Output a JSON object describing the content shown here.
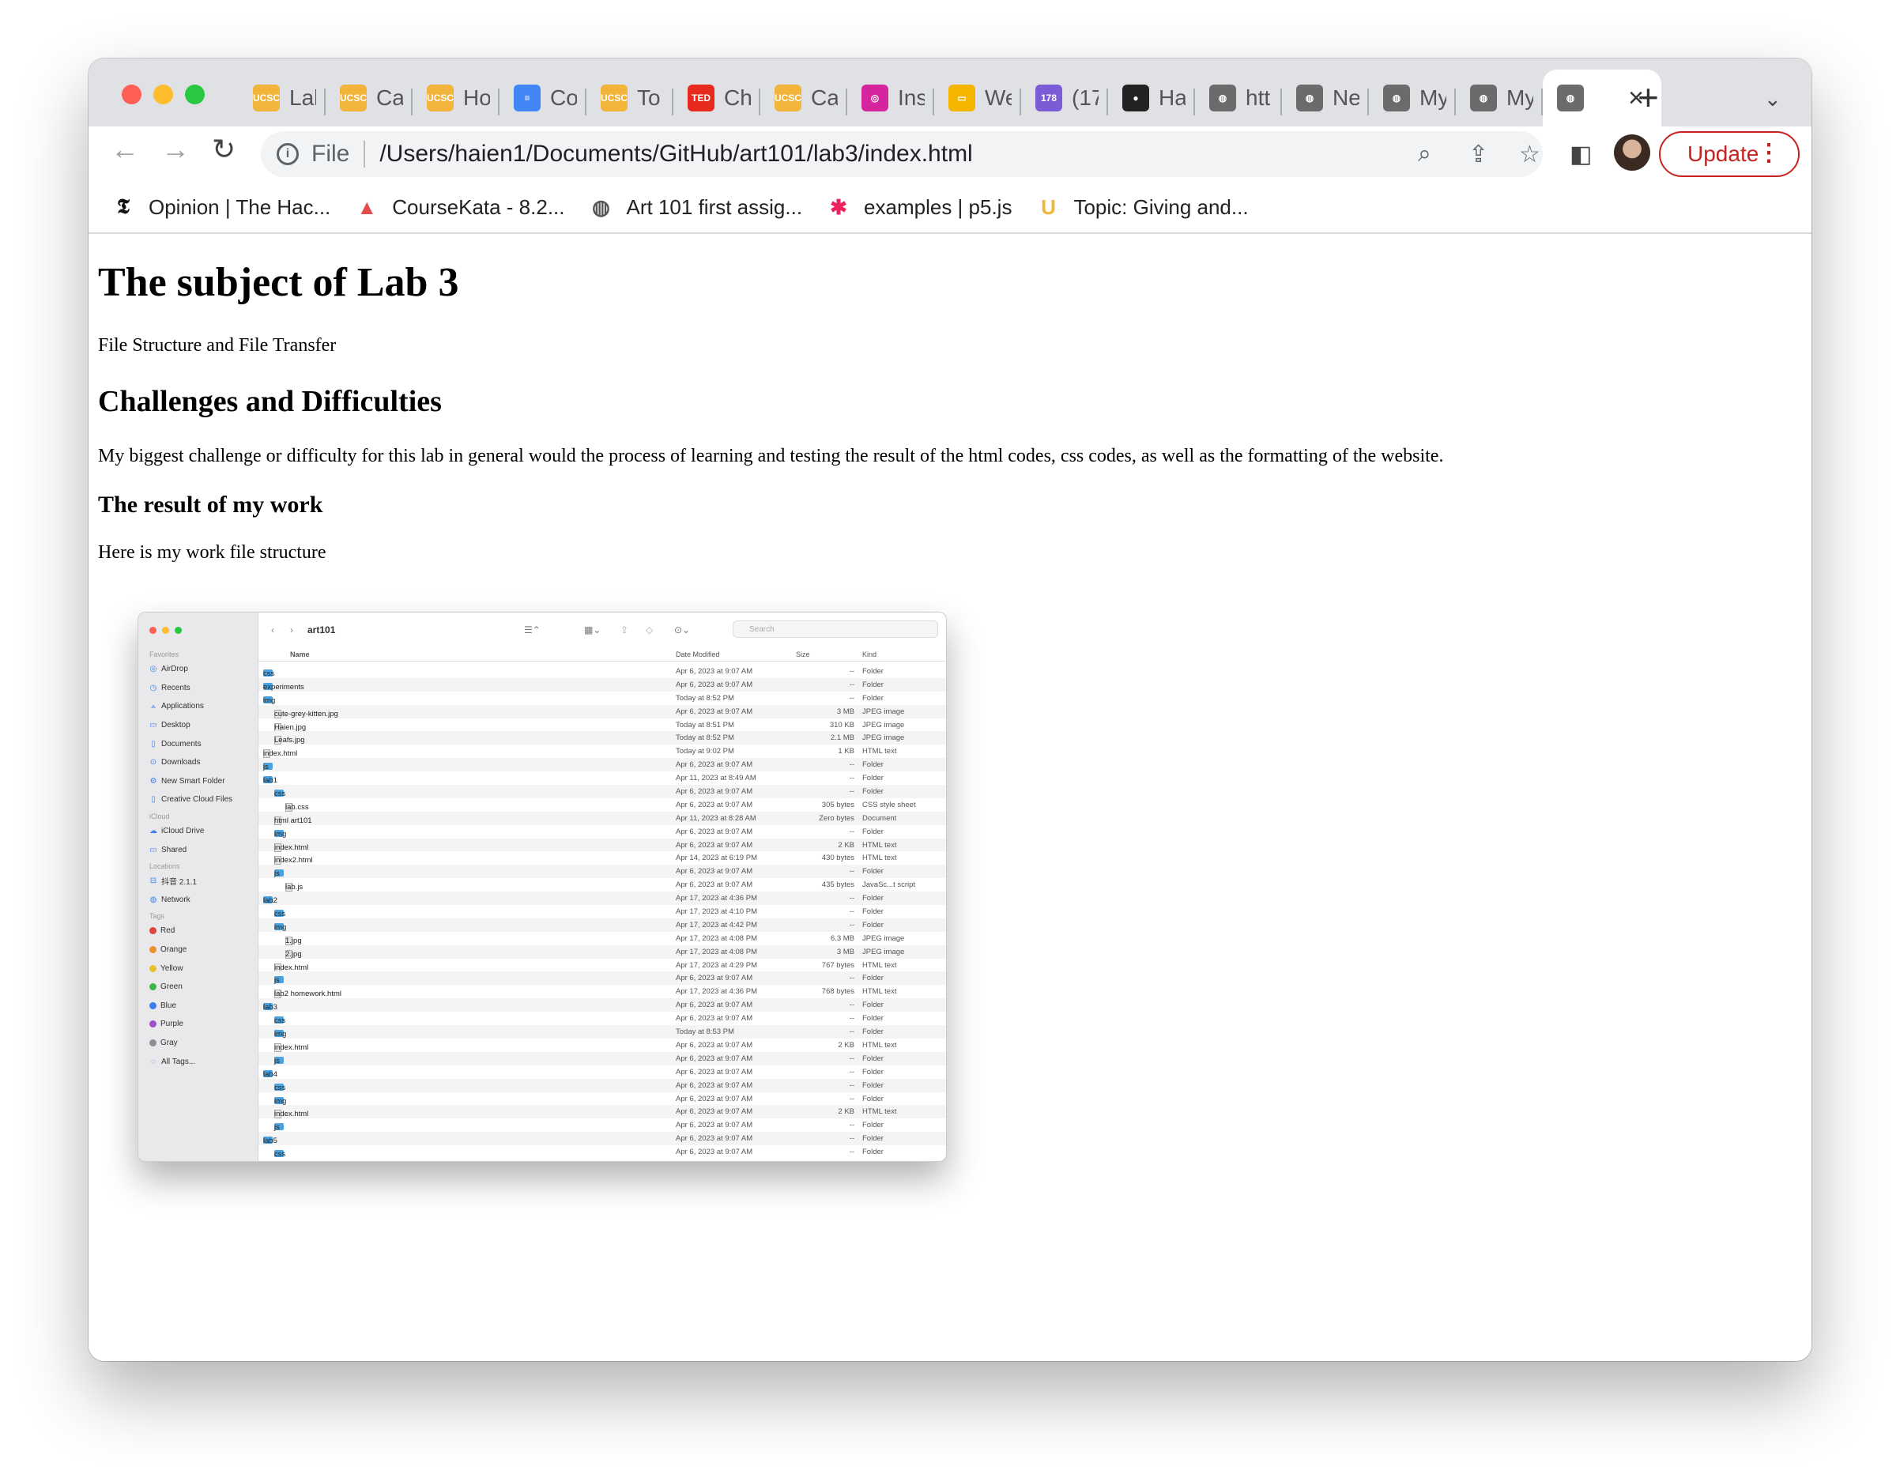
{
  "browser": {
    "tabs": [
      {
        "title": "Lab",
        "fav": "UCSC",
        "color": "#f2b43a"
      },
      {
        "title": "Ca",
        "fav": "UCSC",
        "color": "#f2b43a"
      },
      {
        "title": "Ho",
        "fav": "UCSC",
        "color": "#f2b43a"
      },
      {
        "title": "Co",
        "fav": "≡",
        "color": "#4285f4"
      },
      {
        "title": "To",
        "fav": "UCSC",
        "color": "#f2b43a"
      },
      {
        "title": "Ch",
        "fav": "TED",
        "color": "#e62b1e"
      },
      {
        "title": "Ca",
        "fav": "UCSC",
        "color": "#f2b43a"
      },
      {
        "title": "Ins",
        "fav": "◎",
        "color": "#d6249f"
      },
      {
        "title": "We",
        "fav": "▭",
        "color": "#f4b400"
      },
      {
        "title": "(17",
        "fav": "178",
        "color": "#7b5cd6"
      },
      {
        "title": "Ha",
        "fav": "●",
        "color": "#222222"
      },
      {
        "title": "htt",
        "fav": "◍",
        "color": "#6b6b6b"
      },
      {
        "title": "Ne",
        "fav": "◍",
        "color": "#6b6b6b"
      },
      {
        "title": "My",
        "fav": "◍",
        "color": "#6b6b6b"
      },
      {
        "title": "My",
        "fav": "◍",
        "color": "#6b6b6b"
      }
    ],
    "address": {
      "scheme": "File",
      "url": "/Users/haien1/Documents/GitHub/art101/lab3/index.html"
    },
    "update_label": "Update",
    "bookmarks": [
      {
        "label": "Opinion | The Hac...",
        "icon": "𝕿",
        "color": "#111111"
      },
      {
        "label": "CourseKata - 8.2...",
        "icon": "▲",
        "color": "#e24c4c"
      },
      {
        "label": "Art 101 first assig...",
        "icon": "◍",
        "color": "#555555"
      },
      {
        "label": "examples | p5.js",
        "icon": "✱",
        "color": "#ed225d"
      },
      {
        "label": "Topic: Giving and...",
        "icon": "U",
        "color": "#f2b43a"
      }
    ]
  },
  "page": {
    "title": "The subject of Lab 3",
    "subtitle": "File Structure and File Transfer",
    "challenges_heading": "Challenges and Difficulties",
    "challenges_text": "My biggest challenge or difficulty for this lab in general would the process of learning and testing the result of the html codes, css codes, as well as the formatting of the website.",
    "result_heading": "The result of my work",
    "result_text": "Here is my work file structure"
  },
  "finder": {
    "path": "art101",
    "search_placeholder": "Search",
    "columns": [
      "Name",
      "Date Modified",
      "Size",
      "Kind"
    ],
    "sidebar": [
      {
        "section": "Favorites"
      },
      {
        "label": "AirDrop",
        "icon": "◎"
      },
      {
        "label": "Recents",
        "icon": "◷"
      },
      {
        "label": "Applications",
        "icon": "⟑"
      },
      {
        "label": "Desktop",
        "icon": "▭"
      },
      {
        "label": "Documents",
        "icon": "▯"
      },
      {
        "label": "Downloads",
        "icon": "⊙"
      },
      {
        "label": "New Smart Folder",
        "icon": "⚙"
      },
      {
        "label": "Creative Cloud Files",
        "icon": "▯"
      },
      {
        "section": "iCloud"
      },
      {
        "label": "iCloud Drive",
        "icon": "☁"
      },
      {
        "label": "Shared",
        "icon": "▭"
      },
      {
        "section": "Locations"
      },
      {
        "label": "抖音 2.1.1",
        "icon": "⊟"
      },
      {
        "label": "Network",
        "icon": "◍"
      },
      {
        "section": "Tags"
      },
      {
        "label": "Red",
        "tag": "#e0443a"
      },
      {
        "label": "Orange",
        "tag": "#f0902a"
      },
      {
        "label": "Yellow",
        "tag": "#e8c12a"
      },
      {
        "label": "Green",
        "tag": "#3cb84a"
      },
      {
        "label": "Blue",
        "tag": "#3a7ff0"
      },
      {
        "label": "Purple",
        "tag": "#a050d0"
      },
      {
        "label": "Gray",
        "tag": "#8e8e93"
      },
      {
        "label": "All Tags...",
        "icon": "◌"
      }
    ],
    "rows": [
      {
        "d": 0,
        "c": ">",
        "t": "f",
        "name": "css",
        "date": "Apr 6, 2023 at 9:07 AM",
        "size": "--",
        "kind": "Folder"
      },
      {
        "d": 0,
        "c": ">",
        "t": "f",
        "name": "experiments",
        "date": "Apr 6, 2023 at 9:07 AM",
        "size": "--",
        "kind": "Folder"
      },
      {
        "d": 0,
        "c": "v",
        "t": "f",
        "name": "img",
        "date": "Today at 8:52 PM",
        "size": "--",
        "kind": "Folder"
      },
      {
        "d": 1,
        "c": "",
        "t": "d",
        "name": "cute-grey-kitten.jpg",
        "date": "Apr 6, 2023 at 9:07 AM",
        "size": "3 MB",
        "kind": "JPEG image"
      },
      {
        "d": 1,
        "c": "",
        "t": "d",
        "name": "Haien.jpg",
        "date": "Today at 8:51 PM",
        "size": "310 KB",
        "kind": "JPEG image"
      },
      {
        "d": 1,
        "c": "",
        "t": "d",
        "name": "Leafs.jpg",
        "date": "Today at 8:52 PM",
        "size": "2.1 MB",
        "kind": "JPEG image"
      },
      {
        "d": 0,
        "c": "",
        "t": "d",
        "name": "index.html",
        "date": "Today at 9:02 PM",
        "size": "1 KB",
        "kind": "HTML text"
      },
      {
        "d": 0,
        "c": ">",
        "t": "f",
        "name": "js",
        "date": "Apr 6, 2023 at 9:07 AM",
        "size": "--",
        "kind": "Folder"
      },
      {
        "d": 0,
        "c": "v",
        "t": "f",
        "name": "lab1",
        "date": "Apr 11, 2023 at 8:49 AM",
        "size": "--",
        "kind": "Folder"
      },
      {
        "d": 1,
        "c": "v",
        "t": "f",
        "name": "css",
        "date": "Apr 6, 2023 at 9:07 AM",
        "size": "--",
        "kind": "Folder"
      },
      {
        "d": 2,
        "c": "",
        "t": "d",
        "name": "lab.css",
        "date": "Apr 6, 2023 at 9:07 AM",
        "size": "305 bytes",
        "kind": "CSS style sheet"
      },
      {
        "d": 1,
        "c": "",
        "t": "d",
        "name": "html art101",
        "date": "Apr 11, 2023 at 8:28 AM",
        "size": "Zero bytes",
        "kind": "Document"
      },
      {
        "d": 1,
        "c": "v",
        "t": "f",
        "name": "img",
        "date": "Apr 6, 2023 at 9:07 AM",
        "size": "--",
        "kind": "Folder"
      },
      {
        "d": 1,
        "c": "",
        "t": "d",
        "name": "index.html",
        "date": "Apr 6, 2023 at 9:07 AM",
        "size": "2 KB",
        "kind": "HTML text"
      },
      {
        "d": 1,
        "c": "",
        "t": "d",
        "name": "index2.html",
        "date": "Apr 14, 2023 at 6:19 PM",
        "size": "430 bytes",
        "kind": "HTML text"
      },
      {
        "d": 1,
        "c": "v",
        "t": "f",
        "name": "js",
        "date": "Apr 6, 2023 at 9:07 AM",
        "size": "--",
        "kind": "Folder"
      },
      {
        "d": 2,
        "c": "",
        "t": "d",
        "name": "lab.js",
        "date": "Apr 6, 2023 at 9:07 AM",
        "size": "435 bytes",
        "kind": "JavaSc...t script"
      },
      {
        "d": 0,
        "c": "v",
        "t": "f",
        "name": "lab2",
        "date": "Apr 17, 2023 at 4:36 PM",
        "size": "--",
        "kind": "Folder"
      },
      {
        "d": 1,
        "c": ">",
        "t": "f",
        "name": "css",
        "date": "Apr 17, 2023 at 4:10 PM",
        "size": "--",
        "kind": "Folder"
      },
      {
        "d": 1,
        "c": "v",
        "t": "f",
        "name": "img",
        "date": "Apr 17, 2023 at 4:42 PM",
        "size": "--",
        "kind": "Folder"
      },
      {
        "d": 2,
        "c": "",
        "t": "d",
        "name": "1.jpg",
        "date": "Apr 17, 2023 at 4:08 PM",
        "size": "6.3 MB",
        "kind": "JPEG image"
      },
      {
        "d": 2,
        "c": "",
        "t": "d",
        "name": "2.jpg",
        "date": "Apr 17, 2023 at 4:08 PM",
        "size": "3 MB",
        "kind": "JPEG image"
      },
      {
        "d": 1,
        "c": "",
        "t": "d",
        "name": "index.html",
        "date": "Apr 17, 2023 at 4:29 PM",
        "size": "767 bytes",
        "kind": "HTML text"
      },
      {
        "d": 1,
        "c": ">",
        "t": "f",
        "name": "js",
        "date": "Apr 6, 2023 at 9:07 AM",
        "size": "--",
        "kind": "Folder"
      },
      {
        "d": 1,
        "c": "",
        "t": "d",
        "name": "lab2 homework.html",
        "date": "Apr 17, 2023 at 4:36 PM",
        "size": "768 bytes",
        "kind": "HTML text"
      },
      {
        "d": 0,
        "c": "v",
        "t": "f",
        "name": "lab3",
        "date": "Apr 6, 2023 at 9:07 AM",
        "size": "--",
        "kind": "Folder"
      },
      {
        "d": 1,
        "c": ">",
        "t": "f",
        "name": "css",
        "date": "Apr 6, 2023 at 9:07 AM",
        "size": "--",
        "kind": "Folder"
      },
      {
        "d": 1,
        "c": ">",
        "t": "f",
        "name": "img",
        "date": "Today at 8:53 PM",
        "size": "--",
        "kind": "Folder"
      },
      {
        "d": 1,
        "c": "",
        "t": "d",
        "name": "index.html",
        "date": "Apr 6, 2023 at 9:07 AM",
        "size": "2 KB",
        "kind": "HTML text"
      },
      {
        "d": 1,
        "c": ">",
        "t": "f",
        "name": "js",
        "date": "Apr 6, 2023 at 9:07 AM",
        "size": "--",
        "kind": "Folder"
      },
      {
        "d": 0,
        "c": "v",
        "t": "f",
        "name": "lab4",
        "date": "Apr 6, 2023 at 9:07 AM",
        "size": "--",
        "kind": "Folder"
      },
      {
        "d": 1,
        "c": ">",
        "t": "f",
        "name": "css",
        "date": "Apr 6, 2023 at 9:07 AM",
        "size": "--",
        "kind": "Folder"
      },
      {
        "d": 1,
        "c": "v",
        "t": "f",
        "name": "img",
        "date": "Apr 6, 2023 at 9:07 AM",
        "size": "--",
        "kind": "Folder"
      },
      {
        "d": 1,
        "c": "",
        "t": "d",
        "name": "index.html",
        "date": "Apr 6, 2023 at 9:07 AM",
        "size": "2 KB",
        "kind": "HTML text"
      },
      {
        "d": 1,
        "c": ">",
        "t": "f",
        "name": "js",
        "date": "Apr 6, 2023 at 9:07 AM",
        "size": "--",
        "kind": "Folder"
      },
      {
        "d": 0,
        "c": "v",
        "t": "f",
        "name": "lab5",
        "date": "Apr 6, 2023 at 9:07 AM",
        "size": "--",
        "kind": "Folder"
      },
      {
        "d": 1,
        "c": ">",
        "t": "f",
        "name": "css",
        "date": "Apr 6, 2023 at 9:07 AM",
        "size": "--",
        "kind": "Folder"
      }
    ]
  }
}
